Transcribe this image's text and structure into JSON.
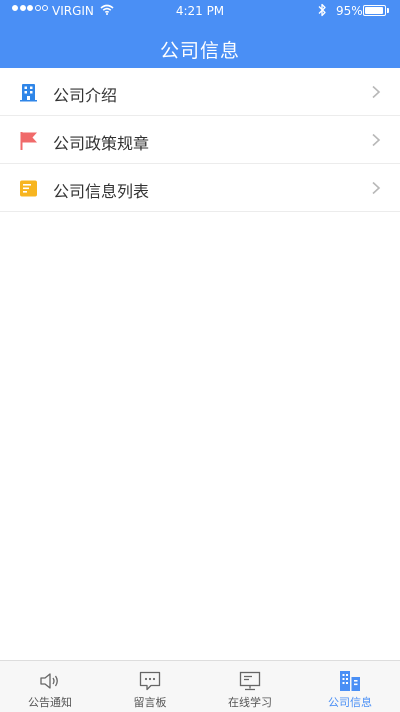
{
  "status_bar": {
    "carrier": "VIRGIN",
    "time": "4:21 PM",
    "battery": "95%",
    "battery_level": 0.95,
    "signal_bars": 3,
    "signal_total": 5
  },
  "nav": {
    "title": "公司信息"
  },
  "list": {
    "items": [
      {
        "label": "公司介绍",
        "icon": "building-icon",
        "color": "#2f86e8"
      },
      {
        "label": "公司政策规章",
        "icon": "flag-icon",
        "color": "#f06a6a"
      },
      {
        "label": "公司信息列表",
        "icon": "list-note-icon",
        "color": "#f7b520"
      }
    ]
  },
  "tabbar": {
    "tabs": [
      {
        "label": "公告通知",
        "icon": "speaker-icon"
      },
      {
        "label": "留言板",
        "icon": "chat-bubble-icon"
      },
      {
        "label": "在线学习",
        "icon": "monitor-icon"
      },
      {
        "label": "公司信息",
        "icon": "buildings-icon",
        "active": true
      }
    ]
  },
  "colors": {
    "accent": "#4a8ff5",
    "text": "#333333",
    "tab_inactive": "#555555",
    "chevron": "#b8b8b8"
  }
}
